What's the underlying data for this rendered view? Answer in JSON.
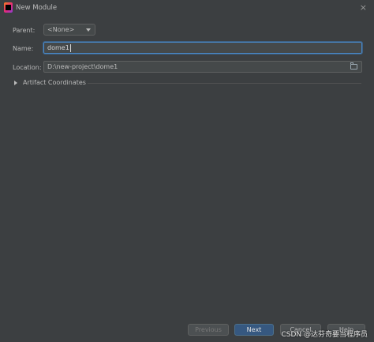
{
  "window": {
    "title": "New Module",
    "close_glyph": "×"
  },
  "form": {
    "parent_label": "Parent:",
    "parent_value": "<None>",
    "name_label": "Name:",
    "name_value": "dome1",
    "location_label": "Location:",
    "location_value": "D:\\new-project\\dome1",
    "artifact_label": "Artifact Coordinates"
  },
  "buttons": {
    "previous": "Previous",
    "next": "Next",
    "cancel": "Cancel",
    "help": "Help"
  },
  "watermark": "CSDN @达芬奇要当程序员",
  "icons": [
    "intellij-app-icon",
    "close-icon",
    "dropdown-arrow-icon",
    "folder-icon",
    "expand-triangle-icon"
  ],
  "colors": {
    "background": "#3c3f41",
    "focus_border": "#4a88c7",
    "primary_button": "#365880"
  }
}
